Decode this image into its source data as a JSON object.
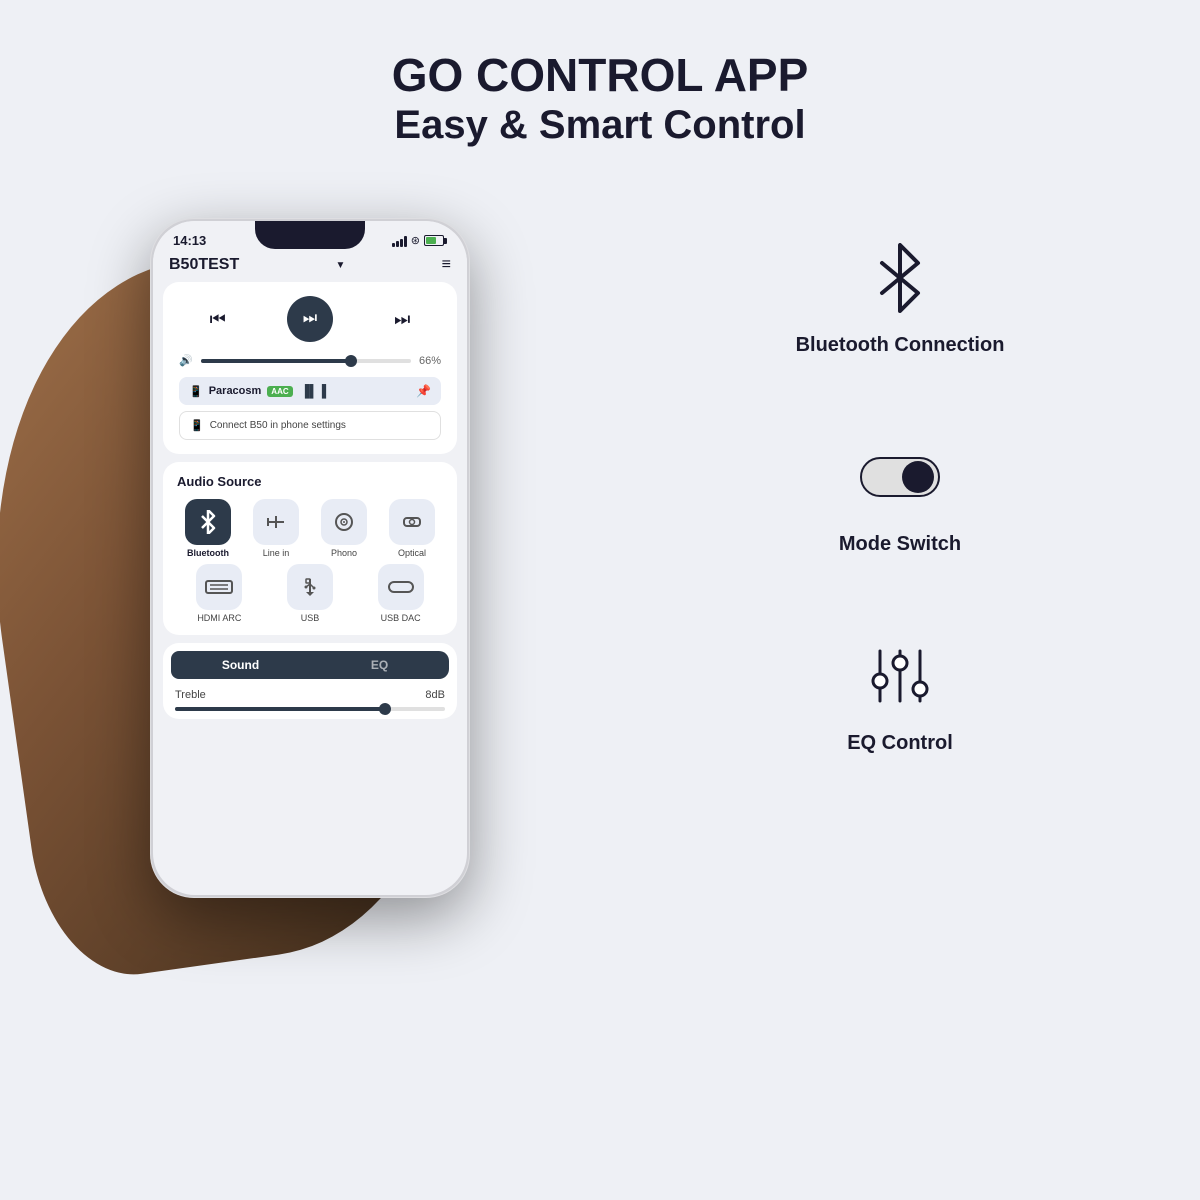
{
  "header": {
    "title_line1": "GO CONTROL APP",
    "title_line2": "Easy & Smart Control"
  },
  "phone": {
    "status_time": "14:13",
    "app_name": "B50TEST",
    "volume_percent": "66%",
    "device_name": "Paracosm",
    "codec": "AAC",
    "connect_text": "Connect B50 in phone settings",
    "audio_source_title": "Audio Source",
    "sources": [
      {
        "label": "Bluetooth",
        "active": true,
        "icon": "bluetooth"
      },
      {
        "label": "Line in",
        "active": false,
        "icon": "line-in"
      },
      {
        "label": "Phono",
        "active": false,
        "icon": "phono"
      },
      {
        "label": "Optical",
        "active": false,
        "icon": "optical"
      },
      {
        "label": "HDMI ARC",
        "active": false,
        "icon": "hdmi"
      },
      {
        "label": "USB",
        "active": false,
        "icon": "usb"
      },
      {
        "label": "USB DAC",
        "active": false,
        "icon": "usb-dac"
      }
    ],
    "sound_tab": "Sound",
    "eq_tab": "EQ",
    "treble_label": "Treble",
    "treble_value": "8dB"
  },
  "features": [
    {
      "label": "Bluetooth Connection",
      "icon_type": "bluetooth"
    },
    {
      "label": "Mode Switch",
      "icon_type": "toggle"
    },
    {
      "label": "EQ Control",
      "icon_type": "eq"
    }
  ]
}
